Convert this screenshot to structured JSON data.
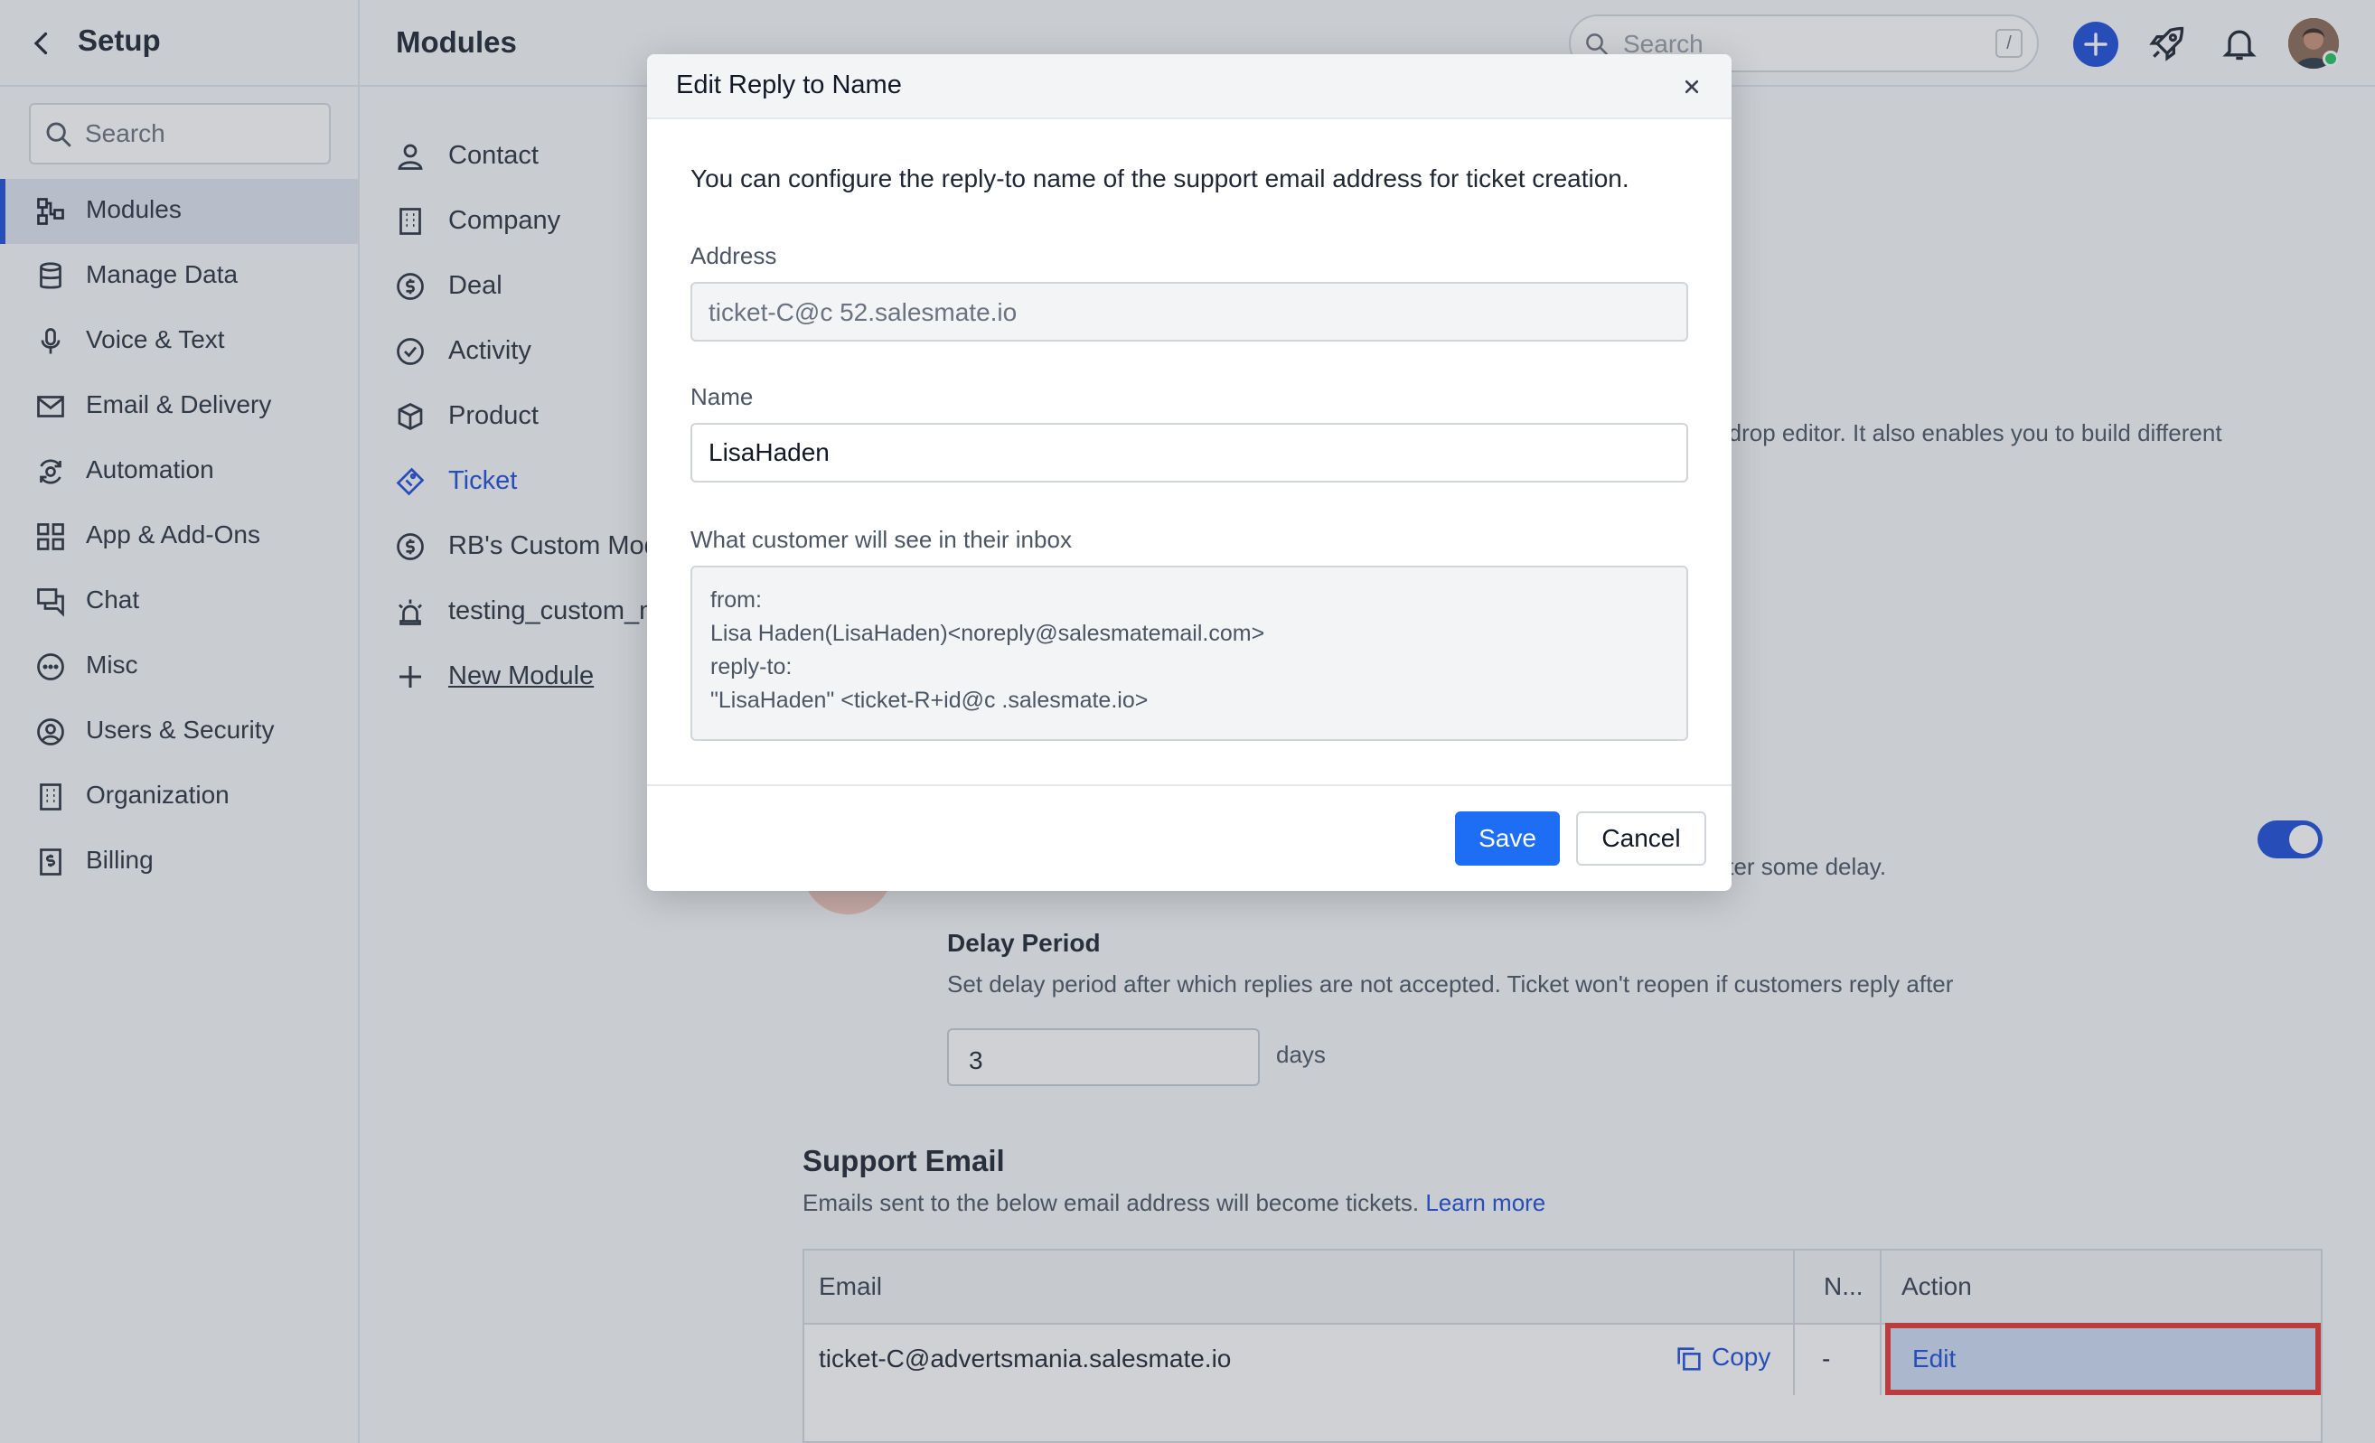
{
  "sidebar": {
    "back_icon": "chevron-left-icon",
    "title": "Setup",
    "search_placeholder": "Search",
    "items": [
      {
        "label": "Modules",
        "icon": "modules-icon",
        "active": true
      },
      {
        "label": "Manage Data",
        "icon": "database-icon"
      },
      {
        "label": "Voice & Text",
        "icon": "microphone-icon"
      },
      {
        "label": "Email & Delivery",
        "icon": "envelope-icon"
      },
      {
        "label": "Automation",
        "icon": "automation-icon"
      },
      {
        "label": "App & Add-Ons",
        "icon": "apps-grid-icon"
      },
      {
        "label": "Chat",
        "icon": "chat-icon"
      },
      {
        "label": "Misc",
        "icon": "more-circle-icon"
      },
      {
        "label": "Users & Security",
        "icon": "user-circle-icon"
      },
      {
        "label": "Organization",
        "icon": "building-icon"
      },
      {
        "label": "Billing",
        "icon": "billing-icon"
      }
    ]
  },
  "topbar": {
    "page_title": "Modules",
    "search_placeholder": "Search",
    "search_shortcut": "/"
  },
  "modules_nav": {
    "items": [
      {
        "label": "Contact",
        "icon": "person-icon"
      },
      {
        "label": "Company",
        "icon": "building-icon"
      },
      {
        "label": "Deal",
        "icon": "dollar-icon"
      },
      {
        "label": "Activity",
        "icon": "check-circle-icon"
      },
      {
        "label": "Product",
        "icon": "box-icon"
      },
      {
        "label": "Ticket",
        "icon": "ticket-icon",
        "active": true
      },
      {
        "label": "RB's Custom Module",
        "icon": "dollar-icon"
      },
      {
        "label": "testing_custom_module",
        "icon": "siren-icon"
      },
      {
        "label": "New Module",
        "icon": "plus-icon"
      }
    ]
  },
  "background": {
    "editor_text": "-drop editor. It also enables you to build different",
    "delay_text": "fter some delay.",
    "delay_period_title": "Delay Period",
    "delay_period_desc": "Set delay period after which replies are not accepted. Ticket won't reopen if customers reply after",
    "delay_value": "3",
    "delay_unit": "days",
    "toggle_on": true,
    "support_email_title": "Support Email",
    "support_email_desc": "Emails sent to the below email address will become tickets.",
    "learn_more": "Learn more",
    "table": {
      "headers": [
        "Email",
        "N...",
        "Action"
      ],
      "rows": [
        {
          "email": "ticket-C@advertsmania.salesmate.io",
          "copy_label": "Copy",
          "name": "-",
          "action": "Edit"
        }
      ]
    }
  },
  "modal": {
    "title": "Edit Reply to Name",
    "intro": "You can configure the reply-to name of the support email address for ticket creation.",
    "address_label": "Address",
    "address_value": "ticket-C@c    52.salesmate.io",
    "name_label": "Name",
    "name_value": "LisaHaden",
    "preview_label": "What customer will see in their inbox",
    "preview_lines": [
      "from:",
      "Lisa Haden(LisaHaden)<noreply@salesmatemail.com>",
      "reply-to:",
      "\"LisaHaden\" <ticket-R+id@c    .salesmate.io>"
    ],
    "save_label": "Save",
    "cancel_label": "Cancel"
  },
  "colors": {
    "accent": "#1d4ed8",
    "save_button": "#1d6ef5",
    "highlight_border": "#e53935"
  }
}
